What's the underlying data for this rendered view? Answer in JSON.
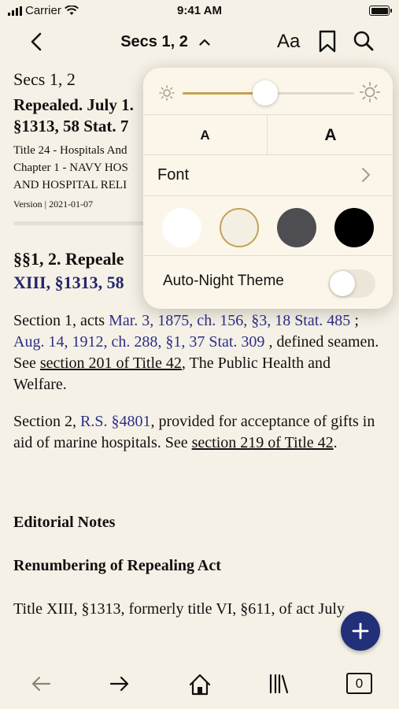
{
  "status_bar": {
    "carrier": "Carrier",
    "time": "9:41 AM"
  },
  "nav": {
    "title": "Secs 1, 2",
    "text_size_label": "Aa"
  },
  "document": {
    "section_title": "Secs 1, 2",
    "repealed_line1": "Repealed. July 1.",
    "repealed_line2": "§1313, 58 Stat. 7",
    "meta_line1": "Title 24 - Hospitals And",
    "meta_line2": "Chapter 1 - NAVY HOS",
    "meta_line3": "AND HOSPITAL RELI",
    "version": "Version | 2021-01-07",
    "heading_line1": "§§1, 2. Repeale",
    "heading_line2": "XIII, §1313, 58",
    "para1": {
      "t1": "Section 1, acts ",
      "link1": "Mar. 3, 1875, ch. 156, §3, 18 Stat. 485",
      "t2": " ; ",
      "link2": "Aug. 14, 1912, ch. 288, §1, 37 Stat. 309",
      "t3": " , defined seamen. See ",
      "link3": "section 201 of Title 42",
      "t4": ", The Public Health and Welfare."
    },
    "para2": {
      "t1": "Section 2, ",
      "link1": "R.S. §4801",
      "t2": ", provided for acceptance of gifts in aid of marine hospitals. See ",
      "link2": "section 219 of Title 42",
      "t3": "."
    },
    "editorial_notes": "Editorial Notes",
    "renumbering_heading": "Renumbering of Repealing Act",
    "last_para": "Title XIII, §1313, formerly title VI, §611, of act July"
  },
  "popover": {
    "brightness_percent": 48,
    "font_size_small_label": "A",
    "font_size_large_label": "A",
    "font_label": "Font",
    "themes": [
      {
        "name": "white",
        "color": "#ffffff",
        "selected": false
      },
      {
        "name": "sepia",
        "color": "#f4efe3",
        "selected": true
      },
      {
        "name": "gray",
        "color": "#4e4e52",
        "selected": false
      },
      {
        "name": "black",
        "color": "#000000",
        "selected": false
      }
    ],
    "auto_night_label": "Auto-Night Theme",
    "auto_night_on": false
  },
  "toolbar": {
    "tab_count": "0"
  },
  "colors": {
    "accent": "#c3a252",
    "link": "#2b2f88",
    "fab": "#22307a",
    "background": "#f6f1e6"
  }
}
